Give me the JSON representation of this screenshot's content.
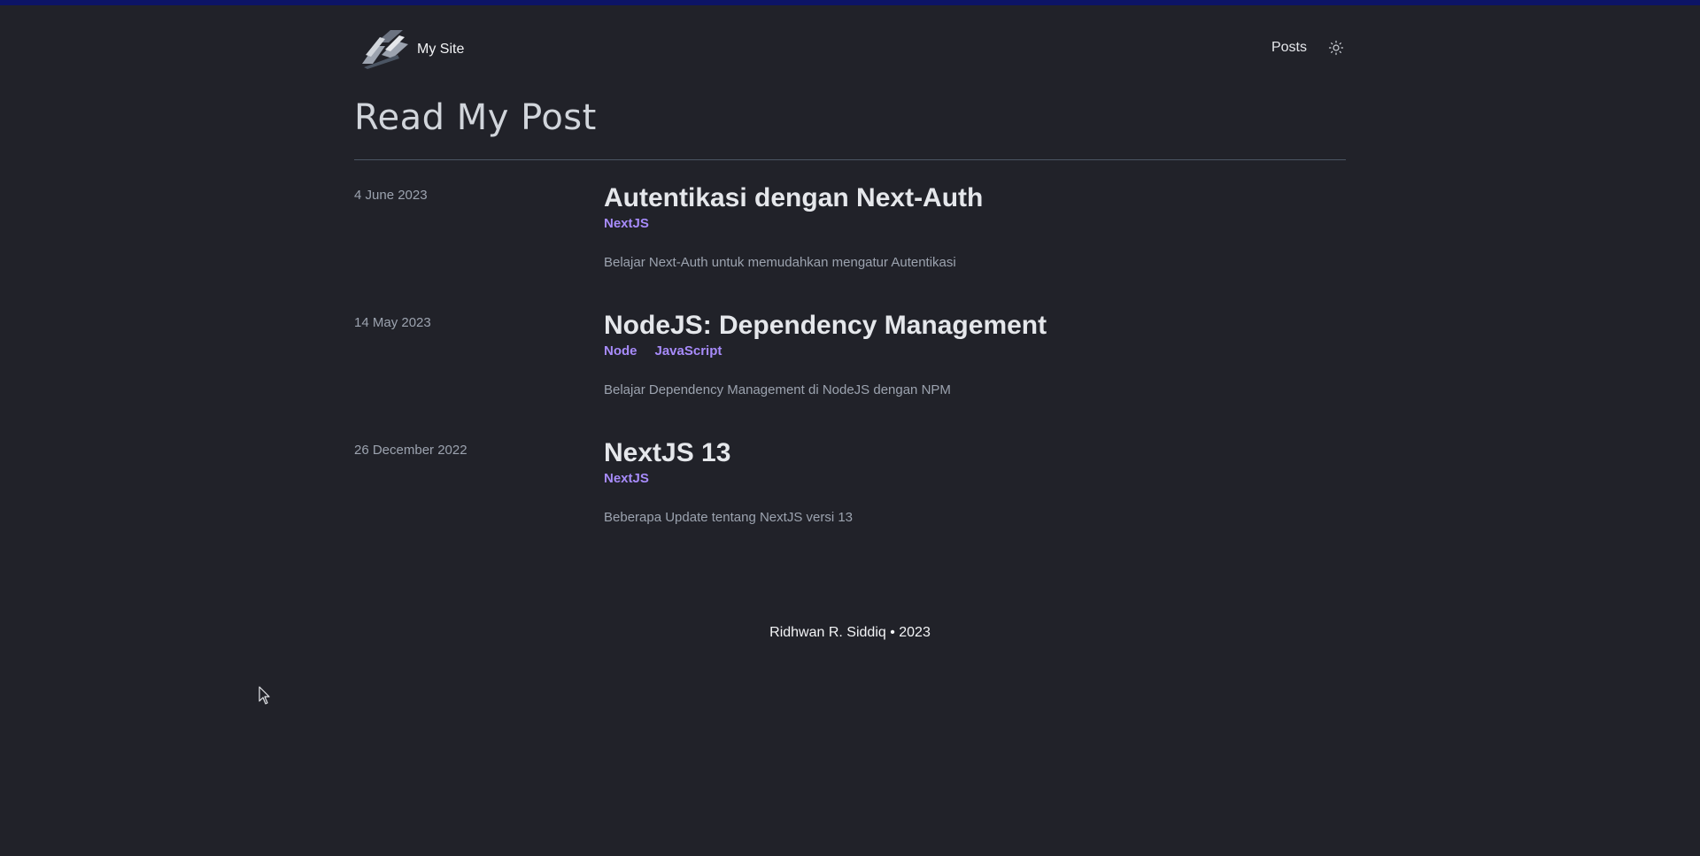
{
  "header": {
    "site_name": "My Site",
    "nav": [
      {
        "label": "Posts"
      }
    ],
    "theme_icon": "sun-icon",
    "logo_icon": "site-logo"
  },
  "main": {
    "title": "Read My Post",
    "posts": [
      {
        "date": "4 June 2023",
        "title": "Autentikasi dengan Next-Auth",
        "tags": [
          "NextJS"
        ],
        "description": "Belajar Next-Auth untuk memudahkan mengatur Autentikasi"
      },
      {
        "date": "14 May 2023",
        "title": "NodeJS: Dependency Management",
        "tags": [
          "Node",
          "JavaScript"
        ],
        "description": "Belajar Dependency Management di NodeJS dengan NPM"
      },
      {
        "date": "26 December 2022",
        "title": "NextJS 13",
        "tags": [
          "NextJS"
        ],
        "description": "Beberapa Update tentang NextJS versi 13"
      }
    ]
  },
  "footer": {
    "text": "Ridhwan R. Siddiq • 2023"
  },
  "colors": {
    "background": "#212229",
    "top_bar": "#0c1466",
    "tag": "#a78bfa",
    "muted_text": "#9ca3af"
  }
}
